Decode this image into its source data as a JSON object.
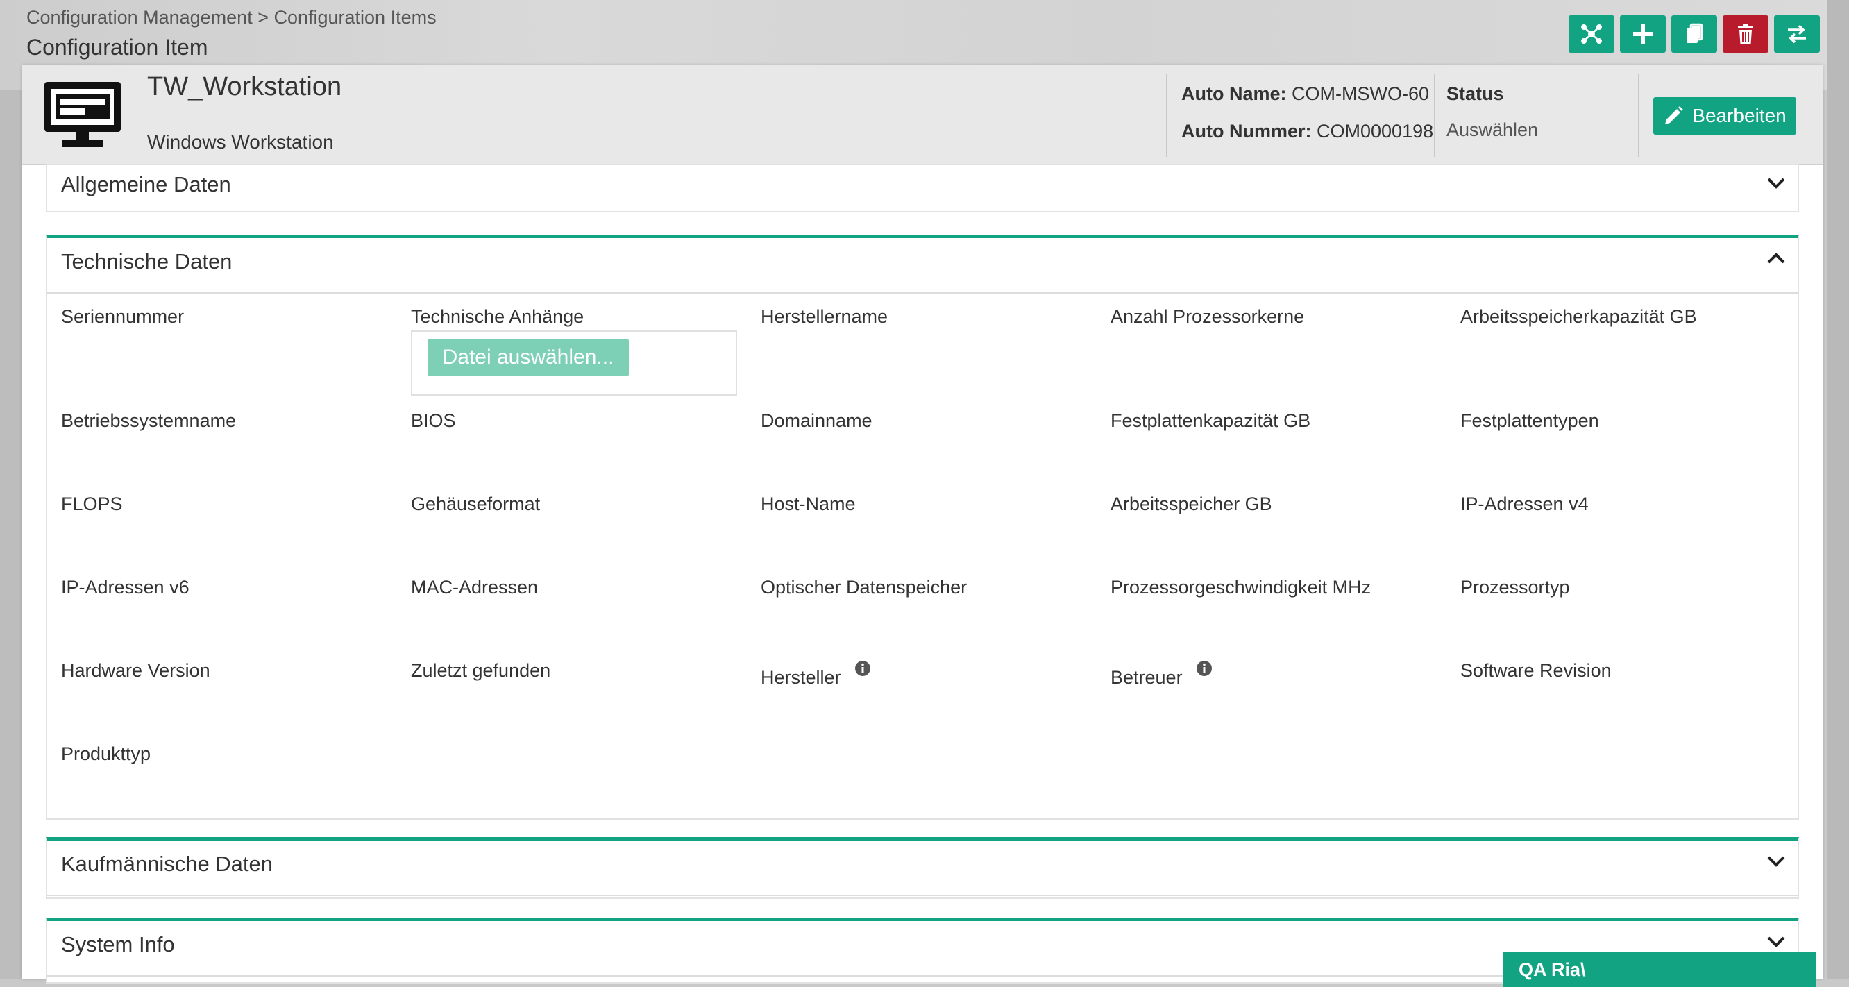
{
  "breadcrumb": "Configuration Management > Configuration Items",
  "page_title": "Configuration Item",
  "toolbar": {
    "buttons": [
      {
        "name": "relations",
        "icon": "network-icon",
        "color": "#12a383"
      },
      {
        "name": "add",
        "icon": "plus-icon",
        "color": "#12a383"
      },
      {
        "name": "copy",
        "icon": "copy-icon",
        "color": "#12a383"
      },
      {
        "name": "delete",
        "icon": "trash-icon",
        "color": "#b81c2c"
      },
      {
        "name": "switch",
        "icon": "swap-icon",
        "color": "#12a383"
      }
    ]
  },
  "ci": {
    "name": "TW_Workstation",
    "type": "Windows Workstation",
    "icon": "monitor-icon",
    "auto_name_label": "Auto Name:",
    "auto_name_value": "COM-MSWO-60",
    "auto_number_label": "Auto Nummer:",
    "auto_number_value": "COM0000198",
    "status_label": "Status",
    "status_value": "Auswählen",
    "edit_label": "Bearbeiten"
  },
  "sections": {
    "general": {
      "title": "Allgemeine Daten",
      "expanded": false
    },
    "technical": {
      "title": "Technische Daten",
      "expanded": true,
      "upload_label": "Datei auswählen...",
      "fields": [
        "Seriennummer",
        "Technische Anhänge",
        "Herstellername",
        "Anzahl Prozessorkerne",
        "Arbeitsspeicherkapazität GB",
        "Betriebssystemname",
        "BIOS",
        "Domainname",
        "Festplattenkapazität GB",
        "Festplattentypen",
        "FLOPS",
        "Gehäuseformat",
        "Host-Name",
        "Arbeitsspeicher GB",
        "IP-Adressen v4",
        "IP-Adressen v6",
        "MAC-Adressen",
        "Optischer Datenspeicher",
        "Prozessorgeschwindigkeit MHz",
        "Prozessortyp",
        "Hardware Version",
        "Zuletzt gefunden",
        "Hersteller",
        "Betreuer",
        "Software Revision",
        "Produkttyp"
      ]
    },
    "commercial": {
      "title": "Kaufmännische Daten",
      "expanded": false
    },
    "system": {
      "title": "System Info",
      "expanded": false
    }
  },
  "user_badge": "QA Ria\\",
  "colors": {
    "accent": "#12a383",
    "danger": "#b81c2c",
    "upload": "#7dcfb6"
  }
}
